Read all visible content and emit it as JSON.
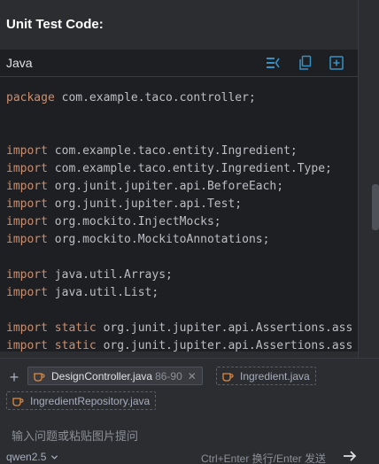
{
  "header": {
    "title": "Unit Test Code:"
  },
  "code_block": {
    "language": "Java",
    "toolbar_icons": [
      "insert-diff-icon",
      "copy-icon",
      "insert-file-icon"
    ],
    "lines": [
      [
        {
          "k": "kw",
          "t": "package"
        },
        {
          "k": "pl",
          "t": " com.example.taco.controller;"
        }
      ],
      [],
      [],
      [
        {
          "k": "kw",
          "t": "import"
        },
        {
          "k": "pl",
          "t": " com.example.taco.entity.Ingredient;"
        }
      ],
      [
        {
          "k": "kw",
          "t": "import"
        },
        {
          "k": "pl",
          "t": " com.example.taco.entity.Ingredient.Type;"
        }
      ],
      [
        {
          "k": "kw",
          "t": "import"
        },
        {
          "k": "pl",
          "t": " org.junit.jupiter.api.BeforeEach;"
        }
      ],
      [
        {
          "k": "kw",
          "t": "import"
        },
        {
          "k": "pl",
          "t": " org.junit.jupiter.api.Test;"
        }
      ],
      [
        {
          "k": "kw",
          "t": "import"
        },
        {
          "k": "pl",
          "t": " org.mockito.InjectMocks;"
        }
      ],
      [
        {
          "k": "kw",
          "t": "import"
        },
        {
          "k": "pl",
          "t": " org.mockito.MockitoAnnotations;"
        }
      ],
      [],
      [
        {
          "k": "kw",
          "t": "import"
        },
        {
          "k": "pl",
          "t": " java.util.Arrays;"
        }
      ],
      [
        {
          "k": "kw",
          "t": "import"
        },
        {
          "k": "pl",
          "t": " java.util.List;"
        }
      ],
      [],
      [
        {
          "k": "kw",
          "t": "import static"
        },
        {
          "k": "pl",
          "t": " org.junit.jupiter.api.Assertions.ass"
        }
      ],
      [
        {
          "k": "kw",
          "t": "import static"
        },
        {
          "k": "pl",
          "t": " org.junit.jupiter.api.Assertions.ass"
        }
      ]
    ]
  },
  "context_files": [
    {
      "name": "DesignController.java",
      "range": "86-90",
      "active": true
    },
    {
      "name": "Ingredient.java",
      "range": "",
      "active": false
    },
    {
      "name": "IngredientRepository.java",
      "range": "",
      "active": false
    }
  ],
  "input": {
    "placeholder": "输入问题或粘贴图片提问",
    "value": ""
  },
  "footer": {
    "model": "qwen2.5",
    "hint": "Ctrl+Enter 换行/Enter 发送"
  },
  "colors": {
    "keyword": "#cf8e6d",
    "plain": "#bcbec4",
    "accent": "#3592c4",
    "file_icon": "#e2893a"
  }
}
